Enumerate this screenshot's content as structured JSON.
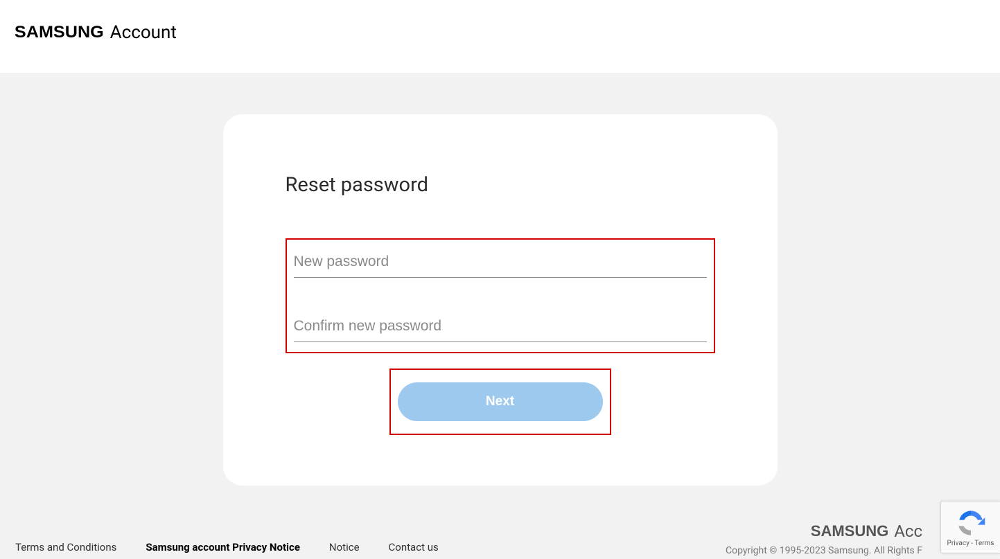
{
  "header": {
    "brand": "SAMSUNG",
    "product": "Account"
  },
  "main": {
    "title": "Reset password",
    "fields": {
      "new_password_placeholder": "New password",
      "new_password_value": "",
      "confirm_password_placeholder": "Confirm new password",
      "confirm_password_value": ""
    },
    "next_button_label": "Next"
  },
  "footer": {
    "links": [
      {
        "label": "Terms and Conditions",
        "bold": false
      },
      {
        "label": "Samsung account Privacy Notice",
        "bold": true
      },
      {
        "label": "Notice",
        "bold": false
      },
      {
        "label": "Contact us",
        "bold": false
      }
    ],
    "brand": "SAMSUNG",
    "product": "Acc",
    "copyright": "Copyright © 1995-2023 Samsung. All Rights F"
  },
  "recaptcha": {
    "privacy": "Privacy",
    "separator": " - ",
    "terms": "Terms"
  }
}
